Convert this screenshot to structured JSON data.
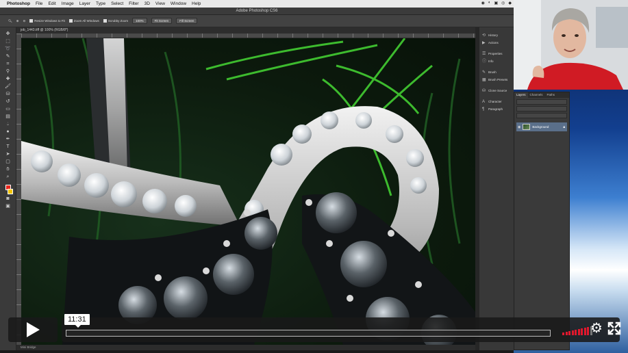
{
  "menubar": {
    "app": "Photoshop",
    "items": [
      "File",
      "Edit",
      "Image",
      "Layer",
      "Type",
      "Select",
      "Filter",
      "3D",
      "View",
      "Window",
      "Help"
    ]
  },
  "window": {
    "title": "Adobe Photoshop CS6"
  },
  "options": {
    "checks": [
      "Resize Windows to Fit",
      "Zoom All Windows",
      "Scrubby Zoom"
    ],
    "buttons": [
      "100%",
      "Fit Screen",
      "Fill Screen"
    ]
  },
  "document": {
    "tab": "job_1443.tiff @ 100% (RGB/8*)"
  },
  "status": {
    "left": "Mini Bridge"
  },
  "dock": {
    "groups": [
      [
        "History",
        "Actions"
      ],
      [
        "Properties",
        "Info"
      ],
      [
        "Brush",
        "Brush Presets"
      ],
      [
        "Clone Source"
      ],
      [
        "Character",
        "Paragraph"
      ]
    ]
  },
  "layers_panel": {
    "tabs": [
      "Layers",
      "Channels",
      "Paths"
    ],
    "layer_name": "Background"
  },
  "player": {
    "timecode": "11:31",
    "progress_fraction": 0.0,
    "volume_level": 0.9
  },
  "colors": {
    "accent_red": "#e0182d",
    "ps_panel": "#3a3a3a",
    "fg_swatch": "#e8261c",
    "bg_swatch": "#f2c400"
  }
}
